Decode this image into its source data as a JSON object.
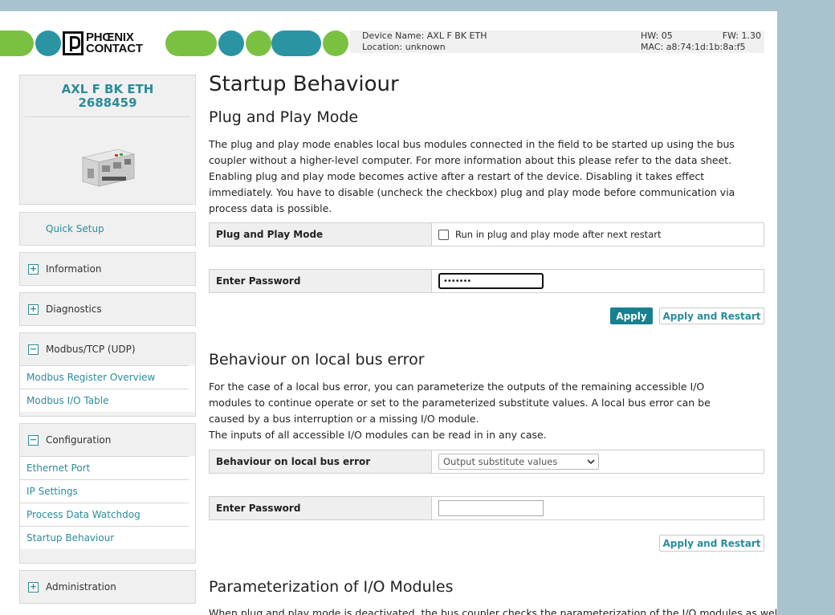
{
  "header": {
    "brand_line1": "PHŒNIX",
    "brand_line2": "CONTACT",
    "device_name": "Device Name: AXL F BK ETH",
    "location": "Location: unknown",
    "hw": "HW: 05",
    "fw": "FW: 1.30",
    "mac": "MAC: a8:74:1d:1b:8a:f5"
  },
  "product": {
    "name": "AXL F BK ETH",
    "number": "2688459"
  },
  "sidebar": {
    "quick_setup": "Quick Setup",
    "information": "Information",
    "diagnostics": "Diagnostics",
    "modbus": "Modbus/TCP (UDP)",
    "modbus_links": [
      "Modbus Register Overview",
      "Modbus I/O Table"
    ],
    "configuration": "Configuration",
    "configuration_links": [
      "Ethernet Port",
      "IP Settings",
      "Process Data Watchdog",
      "Startup Behaviour"
    ],
    "administration": "Administration",
    "plus": "+",
    "minus": "−"
  },
  "main": {
    "title": "Startup Behaviour",
    "pnp": {
      "heading": "Plug and Play Mode",
      "description": "The plug and play mode enables local bus modules connected in the field to be started up using the bus coupler without a higher-level computer. For more information about this please refer to the data sheet. Enabling plug and play mode becomes active after a restart of the device. Disabling it takes effect immediately. You have to disable (uncheck the checkbox) plug and play mode before communication via process data is possible.",
      "mode_label": "Plug and Play Mode",
      "checkbox_label": "Run in plug and play mode after next restart",
      "checkbox_checked": false,
      "password_label": "Enter Password",
      "password_value": "•••••••",
      "apply": "Apply",
      "apply_restart": "Apply and Restart"
    },
    "buserror": {
      "heading": "Behaviour on local bus error",
      "description_1": "For the case of a local bus error, you can parameterize the outputs of the remaining accessible I/O modules to continue operate or set to the parameterized substitute values. A local bus error can be caused by a bus interruption or a missing I/O module.",
      "description_2": "The inputs of all accessible I/O modules can be read in in any case.",
      "label": "Behaviour on local bus error",
      "selected": "Output substitute values",
      "password_label": "Enter Password",
      "password_value": "",
      "apply_restart": "Apply and Restart"
    },
    "param": {
      "heading": "Parameterization of I/O Modules",
      "description": "When plug and play mode is deactivated, the bus coupler checks the parameterization of the I/O modules as well"
    }
  }
}
